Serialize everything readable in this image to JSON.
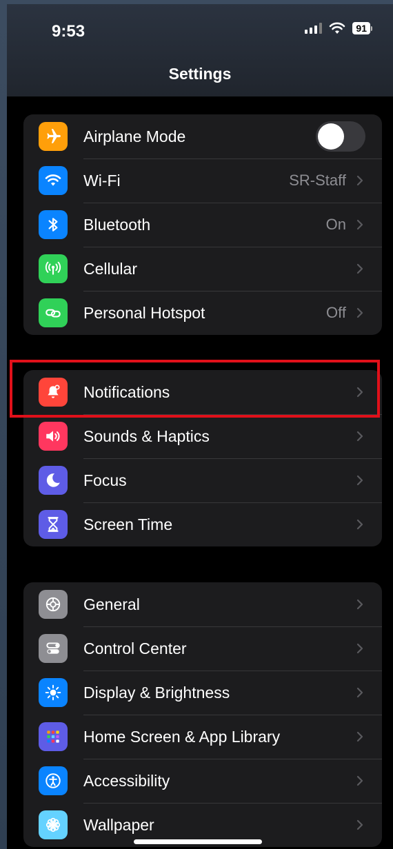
{
  "status": {
    "time": "9:53",
    "battery": "91"
  },
  "nav": {
    "title": "Settings"
  },
  "groups": [
    {
      "items": [
        {
          "label": "Airplane Mode",
          "icon": "airplane-icon",
          "color": "#ff9f0a",
          "control": "toggle",
          "toggle_on": false
        },
        {
          "label": "Wi-Fi",
          "value": "SR-Staff",
          "icon": "wifi-icon",
          "color": "#0a84ff"
        },
        {
          "label": "Bluetooth",
          "value": "On",
          "icon": "bluetooth-icon",
          "color": "#0a84ff"
        },
        {
          "label": "Cellular",
          "value": "",
          "icon": "cellular-icon",
          "color": "#30d158"
        },
        {
          "label": "Personal Hotspot",
          "value": "Off",
          "icon": "hotspot-icon",
          "color": "#30d158"
        }
      ]
    },
    {
      "items": [
        {
          "label": "Notifications",
          "icon": "notifications-icon",
          "color": "#ff453a"
        },
        {
          "label": "Sounds & Haptics",
          "icon": "speaker-icon",
          "color": "#ff375f"
        },
        {
          "label": "Focus",
          "icon": "moon-icon",
          "color": "#5e5ce6"
        },
        {
          "label": "Screen Time",
          "icon": "hourglass-icon",
          "color": "#5e5ce6"
        }
      ]
    },
    {
      "items": [
        {
          "label": "General",
          "icon": "gear-icon",
          "color": "#8e8e93"
        },
        {
          "label": "Control Center",
          "icon": "switches-icon",
          "color": "#8e8e93"
        },
        {
          "label": "Display & Brightness",
          "icon": "sun-icon",
          "color": "#0a84ff"
        },
        {
          "label": "Home Screen & App Library",
          "icon": "home-grid-icon",
          "color": "#5e5ce6"
        },
        {
          "label": "Accessibility",
          "icon": "accessibility-icon",
          "color": "#0a84ff"
        },
        {
          "label": "Wallpaper",
          "icon": "flower-icon",
          "color": "#64d2ff"
        }
      ]
    }
  ],
  "highlight": {
    "target": "Notifications",
    "color": "#e0101a"
  }
}
